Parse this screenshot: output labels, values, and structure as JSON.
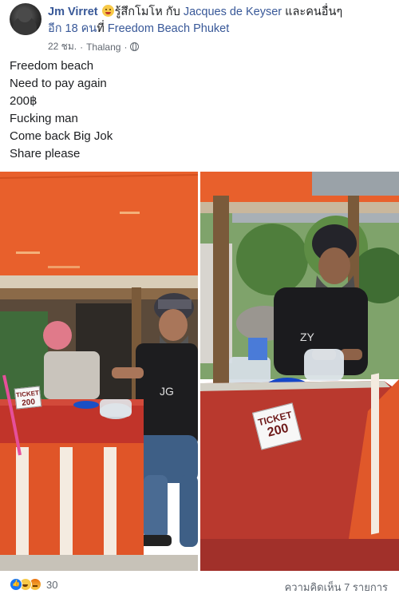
{
  "post": {
    "author": "Jm Virret",
    "feeling": "รู้สึกโมโห",
    "with_text": "กับ",
    "tagged": "Jacques de Keyser",
    "and_others": "และคนอื่นๆ",
    "others_count": "อีก 18 คน",
    "at_text": "ที่",
    "location": "Freedom Beach Phuket",
    "time": "22 ชม.",
    "separator": "·",
    "place": "Thalang",
    "privacy_separator": "·",
    "text_lines": [
      "Freedom beach",
      "Need to pay again",
      "200฿",
      "Fucking man",
      "Come back Big Jok",
      "Share please"
    ]
  },
  "photos": {
    "left_sign_line1": "TICKET",
    "left_sign_line2": "200",
    "right_sign_line1": "TICKET",
    "right_sign_line2": "200"
  },
  "footer": {
    "reactions": [
      "like-icon",
      "haha-icon",
      "angry-icon"
    ],
    "reaction_count": "30",
    "comments": "ความคิดเห็น 7 รายการ"
  },
  "colors": {
    "link": "#385898",
    "meta": "#616770",
    "wall_orange": "#e8602c",
    "table_red": "#c1342a"
  }
}
